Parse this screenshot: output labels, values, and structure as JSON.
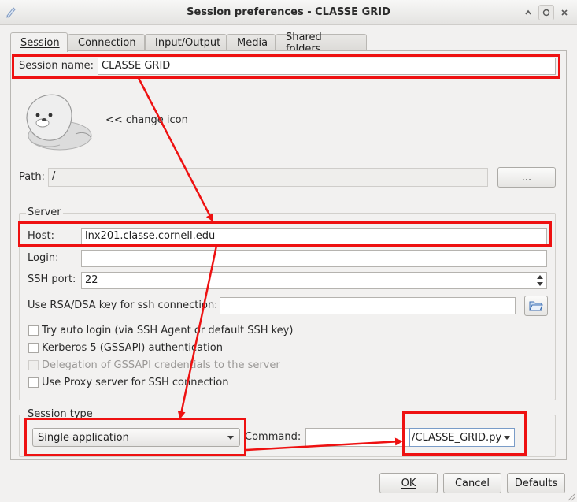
{
  "window": {
    "title": "Session preferences - CLASSE GRID"
  },
  "tabs": [
    {
      "label": "Session",
      "active": true
    },
    {
      "label": "Connection",
      "active": false
    },
    {
      "label": "Input/Output",
      "active": false
    },
    {
      "label": "Media",
      "active": false
    },
    {
      "label": "Shared folders",
      "active": false
    }
  ],
  "session": {
    "name_label": "Session name:",
    "name_value": "CLASSE GRID",
    "change_icon_label": "<< change icon",
    "path_label": "Path:",
    "path_value": "/",
    "browse_label": "..."
  },
  "server": {
    "group_label": "Server",
    "host_label": "Host:",
    "host_value": "lnx201.classe.cornell.edu",
    "login_label": "Login:",
    "login_value": "",
    "ssh_port_label": "SSH port:",
    "ssh_port_value": "22",
    "rsa_label": "Use RSA/DSA key for ssh connection:",
    "rsa_value": "",
    "options": [
      {
        "label": "Try auto login (via SSH Agent or default SSH key)",
        "checked": false,
        "enabled": true
      },
      {
        "label": "Kerberos 5 (GSSAPI) authentication",
        "checked": false,
        "enabled": true
      },
      {
        "label": "Delegation of GSSAPI credentials to the server",
        "checked": false,
        "enabled": false
      },
      {
        "label": "Use Proxy server for SSH connection",
        "checked": false,
        "enabled": true
      }
    ]
  },
  "session_type": {
    "group_label": "Session type",
    "type_value": "Single application",
    "command_label": "Command:",
    "command_value": "",
    "command_combo_value": "/CLASSE_GRID.py"
  },
  "footer": {
    "ok_label": "OK",
    "cancel_label": "Cancel",
    "defaults_label": "Defaults"
  },
  "colors": {
    "annotation": "#ee1111",
    "window_bg": "#f2f1f0"
  },
  "icons": [
    "app-pen-icon",
    "chevron-up-icon",
    "maximize-icon",
    "close-icon",
    "seal-session-icon",
    "folder-open-icon",
    "spin-up-icon",
    "spin-down-icon",
    "dropdown-arrow-icon",
    "resize-grip-icon"
  ]
}
